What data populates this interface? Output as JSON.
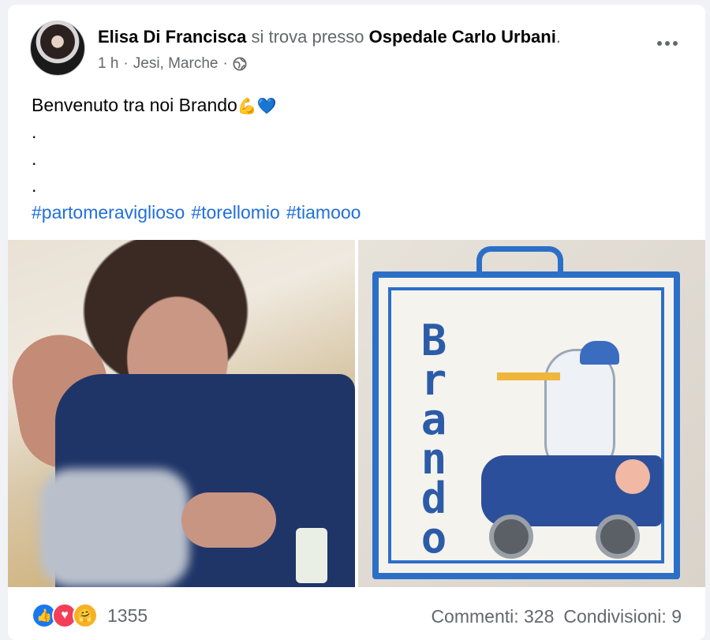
{
  "post": {
    "author": "Elisa Di Francisca",
    "connector": "si trova presso",
    "place": "Ospedale Carlo Urbani",
    "place_suffix": ".",
    "time": "1 h",
    "location": "Jesi, Marche",
    "separator": "·",
    "text_line1": "Benvenuto tra noi Brando",
    "emoji1": "💪",
    "emoji2": "💙",
    "dot": ".",
    "hashtags": [
      "#partomeraviglioso",
      "#torellomio",
      "#tiamooo"
    ]
  },
  "photos": {
    "right_caption": "Brando"
  },
  "footer": {
    "reaction_count": "1355",
    "comments": "Commenti: 328",
    "shares": "Condivisioni: 9"
  },
  "icons": {
    "privacy": "globe-icon",
    "more": "more-options-icon",
    "like": "like-reaction-icon",
    "love": "love-reaction-icon",
    "care": "care-reaction-icon"
  },
  "colors": {
    "hashtag": "#216fdb",
    "muted": "#65676b",
    "like": "#1877f2",
    "love": "#f33e58",
    "care": "#f7b125"
  }
}
